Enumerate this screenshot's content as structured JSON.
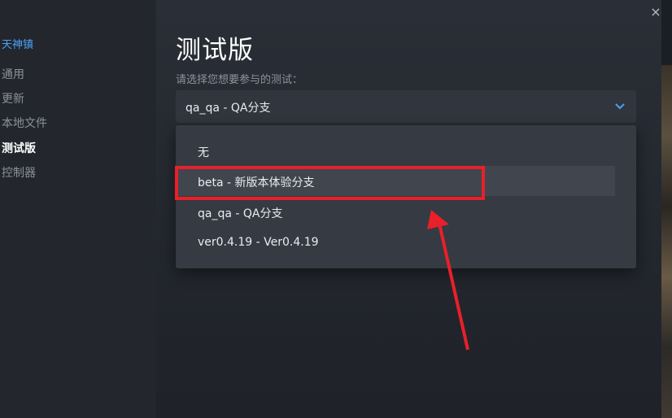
{
  "window": {
    "top_text": "",
    "close_icon": "×"
  },
  "sidebar": {
    "game_title": "天神镇",
    "items": [
      {
        "label": "通用",
        "active": false
      },
      {
        "label": "更新",
        "active": false
      },
      {
        "label": "本地文件",
        "active": false
      },
      {
        "label": "测试版",
        "active": true
      },
      {
        "label": "控制器",
        "active": false
      }
    ]
  },
  "main": {
    "title": "测试版",
    "subtitle": "请选择您想要参与的测试：",
    "select": {
      "value": "qa_qa - QA分支",
      "chevron_icon": "chevron-down-icon"
    },
    "options": [
      {
        "label": "无"
      },
      {
        "label": "beta - 新版本体验分支",
        "hovered": true
      },
      {
        "label": "qa_qa - QA分支"
      },
      {
        "label": "ver0.4.19 - Ver0.4.19"
      }
    ]
  },
  "colors": {
    "accent": "#4aa3f5",
    "annotation": "#e8202a"
  }
}
